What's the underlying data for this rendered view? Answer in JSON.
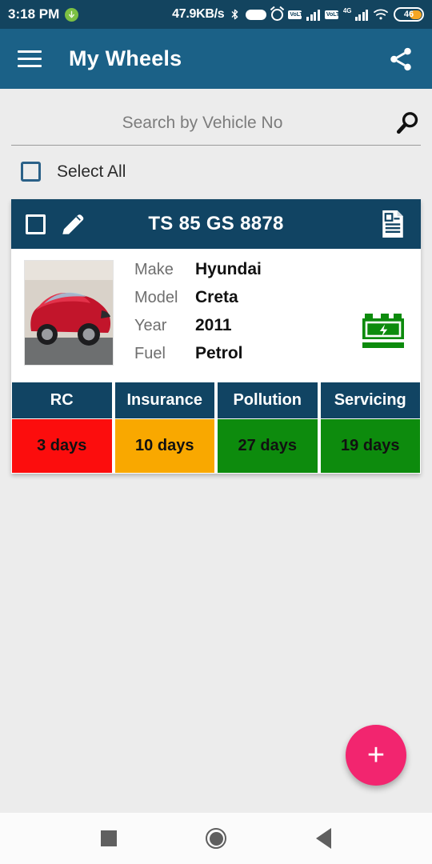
{
  "status_bar": {
    "time": "3:18 PM",
    "download_indicator": "↓",
    "network_speed": "47.9KB/s",
    "volte_label_1": "VoLTE",
    "volte_label_2": "VoLTE",
    "network_type": "4G",
    "battery_level": "46",
    "icons": [
      "download-icon",
      "bluetooth-icon",
      "battery-saver-icon",
      "alarm-icon",
      "volte-icon",
      "signal-icon",
      "volte-icon",
      "signal-icon",
      "wifi-icon",
      "battery-icon"
    ]
  },
  "app_bar": {
    "title": "My Wheels",
    "menu_icon": "hamburger-menu-icon",
    "share_icon": "share-icon",
    "background": "#1b6187"
  },
  "search": {
    "placeholder": "Search by Vehicle No",
    "value": "",
    "icon": "search-icon"
  },
  "select_all": {
    "label": "Select All",
    "checked": false
  },
  "vehicle_card": {
    "plate_number": "TS 85 GS 8878",
    "checkbox_checked": false,
    "edit_icon": "pencil-edit-icon",
    "document_icon": "document-icon",
    "battery_icon": "car-battery-icon",
    "thumbnail_alt": "red sedan car photo",
    "specs": [
      {
        "key": "Make",
        "value": "Hyundai"
      },
      {
        "key": "Model",
        "value": "Creta"
      },
      {
        "key": "Year",
        "value": "2011"
      },
      {
        "key": "Fuel",
        "value": "Petrol"
      }
    ],
    "status_tiles": [
      {
        "label": "RC",
        "value": "3 days",
        "color": "#fc0d0d"
      },
      {
        "label": "Insurance",
        "value": "10 days",
        "color": "#f9a800"
      },
      {
        "label": "Pollution",
        "value": "27 days",
        "color": "#0d8b0d"
      },
      {
        "label": "Servicing",
        "value": "19 days",
        "color": "#0d8b0d"
      }
    ],
    "header_color": "#114463"
  },
  "fab": {
    "label": "+",
    "icon": "add-icon",
    "color": "#f2256f"
  },
  "nav_bar": {
    "recents_icon": "recents-square-icon",
    "home_icon": "home-circle-icon",
    "back_icon": "back-triangle-icon"
  }
}
